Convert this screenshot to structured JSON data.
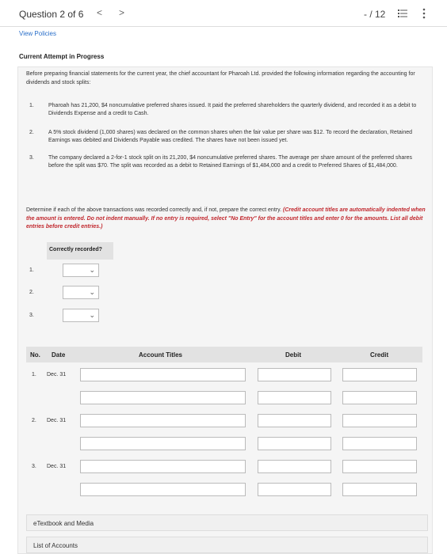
{
  "header": {
    "question": "Question 2 of 6",
    "prev": "<",
    "next": ">",
    "score": "- / 12"
  },
  "links": {
    "view_policies": "View Policies"
  },
  "attempt_label": "Current Attempt in Progress",
  "intro": "Before preparing financial statements for the current year, the chief accountant for Pharoah Ltd. provided the following information regarding the accounting for dividends and stock splits:",
  "items": [
    {
      "num": "1.",
      "text": "Pharoah has 21,200, $4 noncumulative preferred shares issued. It paid the preferred shareholders the quarterly dividend, and recorded it as a debit to Dividends Expense and a credit to Cash."
    },
    {
      "num": "2.",
      "text": "A 5% stock dividend (1,000 shares) was declared on the common shares when the fair value per share was $12. To record the declaration, Retained Earnings was debited and Dividends Payable was credited. The shares have not been issued yet."
    },
    {
      "num": "3.",
      "text": "The company declared a 2-for-1 stock split on its 21,200, $4 noncumulative preferred shares. The average per share amount of the preferred shares before the split was $70. The split was recorded as a debit to Retained Earnings of $1,484,000 and a credit to Preferred Shares of $1,484,000."
    }
  ],
  "instructions": {
    "plain": "Determine if each of the above transactions was recorded correctly and, if not, prepare the correct entry. ",
    "red": "(Credit account titles are automatically indented when the amount is entered. Do not indent manually. If no entry is required, select \"No Entry\" for the account titles and enter 0 for the amounts. List all debit entries before credit entries.)"
  },
  "correctly_recorded": {
    "header": "Correctly recorded?",
    "rows": [
      "1.",
      "2.",
      "3."
    ]
  },
  "journal": {
    "headers": {
      "no": "No.",
      "date": "Date",
      "account": "Account Titles",
      "debit": "Debit",
      "credit": "Credit"
    },
    "entries": [
      {
        "num": "1.",
        "date": "Dec. 31"
      },
      {
        "num": "2.",
        "date": "Dec. 31"
      },
      {
        "num": "3.",
        "date": "Dec. 31"
      }
    ]
  },
  "footer": {
    "etextbook": "eTextbook and Media",
    "list_accounts": "List of Accounts"
  },
  "icons": [
    "chevron-left-icon",
    "chevron-right-icon",
    "list-icon",
    "more-vertical-icon",
    "chevron-down-icon"
  ]
}
